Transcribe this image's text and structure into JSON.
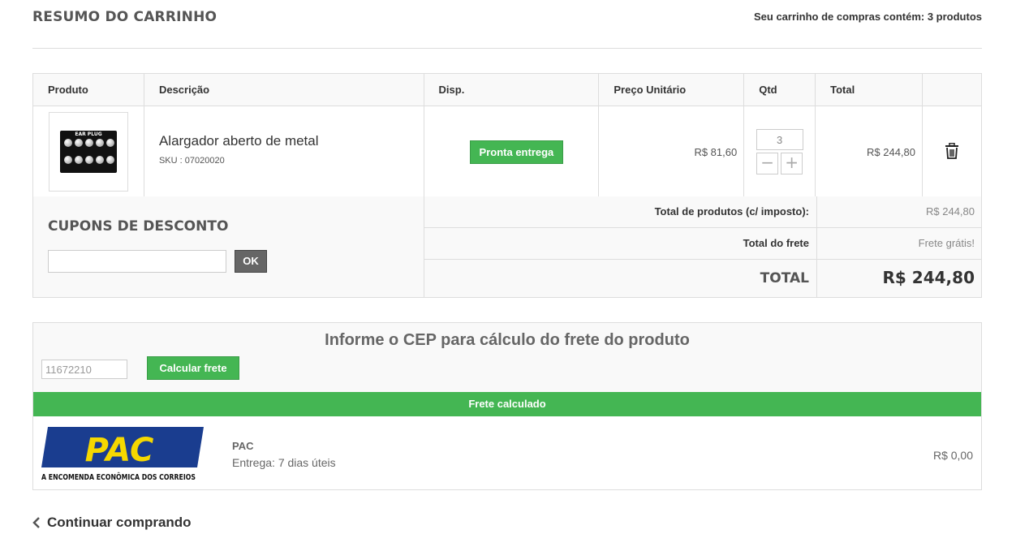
{
  "header": {
    "title": "RESUMO DO CARRINHO",
    "cart_count": "Seu carrinho de compras contém: 3 produtos"
  },
  "table": {
    "columns": [
      "Produto",
      "Descrição",
      "Disp.",
      "Preço Unitário",
      "Qtd",
      "Total"
    ],
    "items": [
      {
        "image_label": "EAR PLUG",
        "name": "Alargador aberto de metal",
        "sku": "SKU : 07020020",
        "availability": "Pronta entrega",
        "unit_price": "R$ 81,60",
        "quantity": "3",
        "total": "R$ 244,80"
      }
    ]
  },
  "coupon": {
    "title": "CUPONS DE DESCONTO",
    "input_value": "",
    "ok_label": "OK"
  },
  "summary": {
    "products_label": "Total de produtos (c/ imposto):",
    "products_value": "R$ 244,80",
    "shipping_label": "Total do frete",
    "shipping_value": "Frete grátis!",
    "total_label": "TOTAL",
    "total_value": "R$ 244,80"
  },
  "shipping": {
    "title": "Informe o CEP para cálculo do frete do produto",
    "cep_value": "11672210",
    "calc_label": "Calcular frete",
    "calculated_label": "Frete calculado",
    "option": {
      "logo_text": "PAC",
      "logo_tagline": "A ENCOMENDA ECONÔMICA DOS CORREIOS",
      "name": "PAC",
      "delivery": "Entrega: 7 dias úteis",
      "price": "R$ 0,00"
    }
  },
  "footer": {
    "continue_label": "Continuar comprando"
  },
  "colors": {
    "green": "#44b653",
    "pac_blue": "#1a3d8f",
    "pac_yellow": "#f5d800"
  }
}
